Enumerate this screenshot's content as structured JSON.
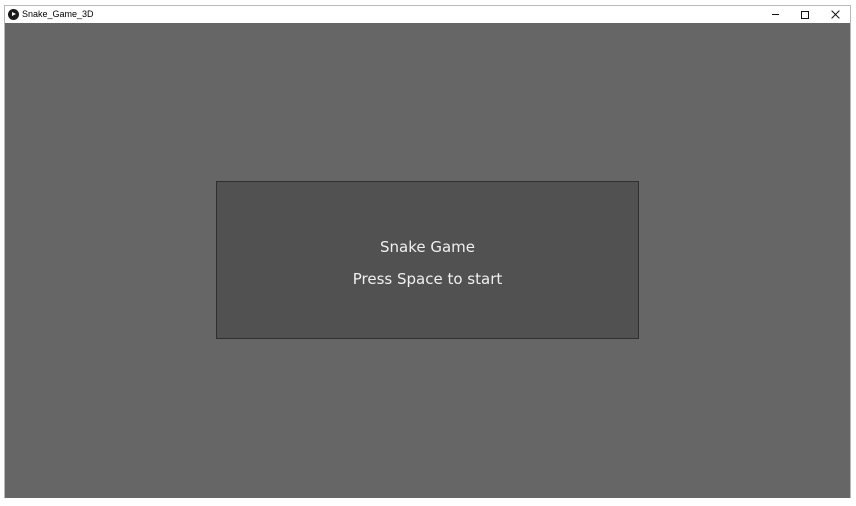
{
  "window": {
    "title": "Snake_Game_3D",
    "icon": "processing-play-icon",
    "controls": {
      "minimize": "minimize-icon",
      "maximize": "maximize-icon",
      "close": "close-icon"
    }
  },
  "game": {
    "title": "Snake Game",
    "prompt": "Press Space to start"
  },
  "colors": {
    "canvas_background": "#666666",
    "dialog_background": "#515151",
    "dialog_border": "#2f2f2f",
    "text": "#f0f0f0"
  }
}
